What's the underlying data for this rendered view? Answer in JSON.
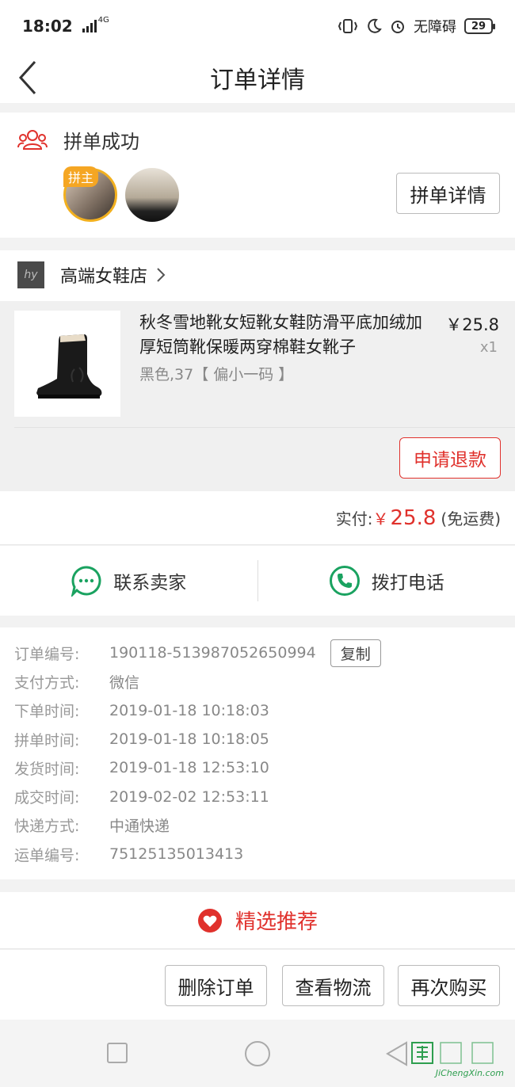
{
  "status_bar": {
    "time": "18:02",
    "network": "4G",
    "accessibility": "无障碍",
    "battery": "29"
  },
  "header": {
    "title": "订单详情"
  },
  "group": {
    "status": "拼单成功",
    "host_tag": "拼主",
    "detail_button": "拼单详情"
  },
  "shop": {
    "name": "高端女鞋店",
    "logo_text": "hy"
  },
  "product": {
    "name": "秋冬雪地靴女短靴女鞋防滑平底加绒加厚短筒靴保暖两穿棉鞋女靴子",
    "sku": "黑色,37【 偏小一码 】",
    "price": "￥25.8",
    "quantity": "x1",
    "refund_button": "申请退款"
  },
  "payment": {
    "label": "实付:",
    "currency": "￥",
    "amount": "25.8",
    "shipping_note": "(免运费)"
  },
  "contact": {
    "seller": "联系卖家",
    "call": "拨打电话"
  },
  "order_info": {
    "rows": [
      {
        "key": "订单编号:",
        "value": "190118-513987052650994"
      },
      {
        "key": "支付方式:",
        "value": "微信"
      },
      {
        "key": "下单时间:",
        "value": "2019-01-18 10:18:03"
      },
      {
        "key": "拼单时间:",
        "value": "2019-01-18 10:18:05"
      },
      {
        "key": "发货时间:",
        "value": "2019-01-18 12:53:10"
      },
      {
        "key": "成交时间:",
        "value": "2019-02-02 12:53:11"
      },
      {
        "key": "快递方式:",
        "value": "中通快递"
      },
      {
        "key": "运单编号:",
        "value": "75125135013413"
      }
    ],
    "copy_button": "复制"
  },
  "recommend": {
    "title": "精选推荐"
  },
  "actions": {
    "delete": "删除订单",
    "logistics": "查看物流",
    "rebuy": "再次购买"
  },
  "watermark": {
    "text": "JiChengXin.com"
  },
  "colors": {
    "accent_red": "#e0312c",
    "green": "#1aa260",
    "host_gold": "#f5a623"
  }
}
